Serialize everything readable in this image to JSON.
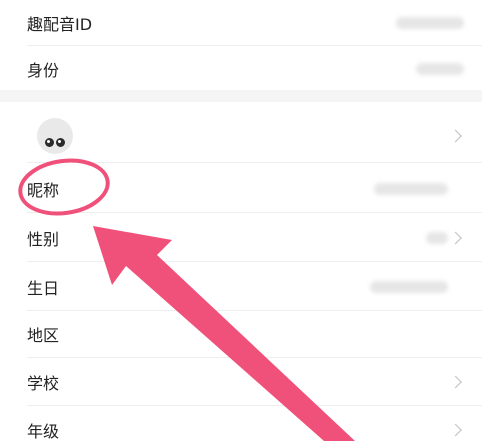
{
  "profile": {
    "rows": [
      {
        "label": "趣配音ID",
        "value": ""
      },
      {
        "label": "身份",
        "value": ""
      },
      {
        "label": "昵称",
        "value": ""
      },
      {
        "label": "性别",
        "value": ""
      },
      {
        "label": "生日",
        "value": ""
      },
      {
        "label": "地区",
        "value": ""
      },
      {
        "label": "学校",
        "value": ""
      },
      {
        "label": "年级",
        "value": ""
      }
    ]
  },
  "icons": {
    "chevron": "chevron-right-icon",
    "avatar": "avatar-icon",
    "annotation_circle": "annotation-circle-icon",
    "annotation_arrow": "annotation-arrow-icon"
  },
  "colors": {
    "annotation": "#f0517a",
    "background": "#ffffff",
    "section_gap": "#f5f5f5",
    "text": "#222222",
    "secondary": "#bdbdbd"
  }
}
